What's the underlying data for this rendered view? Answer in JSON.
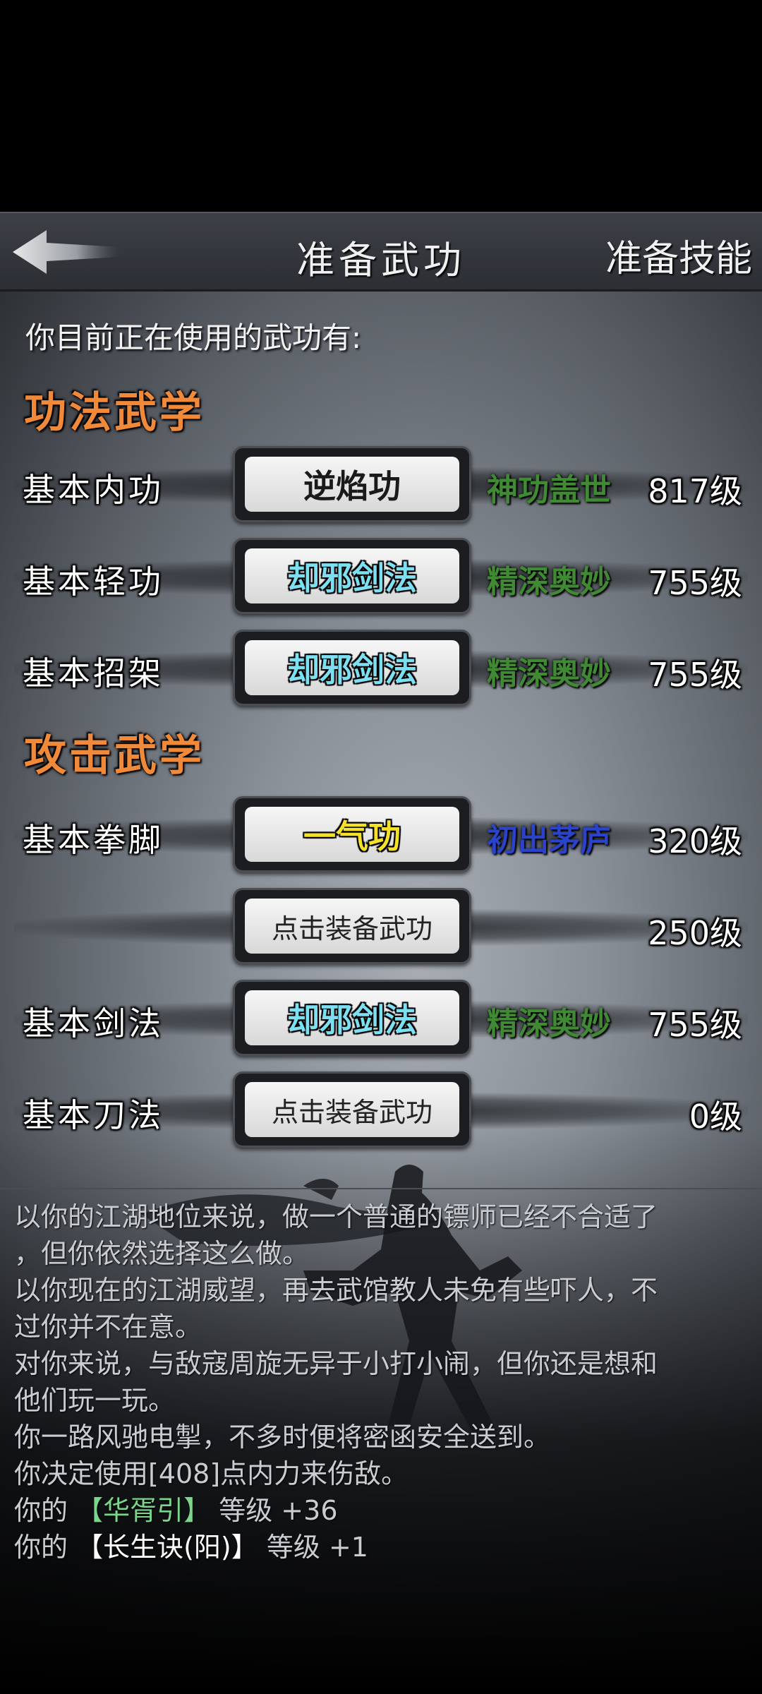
{
  "header": {
    "back_icon": "left-arrow-icon",
    "title": "准备武功",
    "right_label": "准备技能"
  },
  "intro": "你目前正在使用的武功有:",
  "sections": [
    {
      "title": "功法武学",
      "rows": [
        {
          "label": "基本内功",
          "skill": "逆焰功",
          "skill_color": "black",
          "rank": "神功盖世",
          "rank_color": "green",
          "level": "817级"
        },
        {
          "label": "基本轻功",
          "skill": "却邪剑法",
          "skill_color": "cyan",
          "rank": "精深奥妙",
          "rank_color": "green",
          "level": "755级"
        },
        {
          "label": "基本招架",
          "skill": "却邪剑法",
          "skill_color": "cyan",
          "rank": "精深奥妙",
          "rank_color": "green",
          "level": "755级"
        }
      ]
    },
    {
      "title": "攻击武学",
      "rows": [
        {
          "label": "基本拳脚",
          "skill": "一气功",
          "skill_color": "yellow",
          "rank": "初出茅庐",
          "rank_color": "blue",
          "level": "320级"
        },
        {
          "label": "",
          "skill": "点击装备武功",
          "skill_color": "plain",
          "rank": "",
          "rank_color": "",
          "level": "250级"
        },
        {
          "label": "基本剑法",
          "skill": "却邪剑法",
          "skill_color": "cyan",
          "rank": "精深奥妙",
          "rank_color": "green",
          "level": "755级"
        },
        {
          "label": "基本刀法",
          "skill": "点击装备武功",
          "skill_color": "plain",
          "rank": "",
          "rank_color": "",
          "level": "0级"
        }
      ]
    }
  ],
  "log": [
    "以你的江湖地位来说，做一个普通的镖师已经不合适了",
    "，但你依然选择这么做。",
    "以你现在的江湖威望，再去武馆教人未免有些吓人，不",
    "过你并不在意。",
    "对你来说，与敌寇周旋无异于小打小闹，但你还是想和",
    "他们玩一玩。",
    "你一路风驰电掣，不多时便将密函安全送到。",
    "你决定使用[408]点内力来伤敌。"
  ],
  "log_gains": [
    {
      "prefix": "你的",
      "name": "【华胥引】",
      "name_color": "green",
      "suffix": "等级 +36"
    },
    {
      "prefix": "你的",
      "name": "【长生诀(阳)】",
      "name_color": "white",
      "suffix": "等级 +1"
    }
  ],
  "colors": {
    "section_title": "#f08a3a",
    "rank_green": "#3f8a32",
    "rank_blue": "#2a43c8",
    "skill_cyan": "#7de0f2",
    "skill_yellow": "#f5e02a"
  }
}
